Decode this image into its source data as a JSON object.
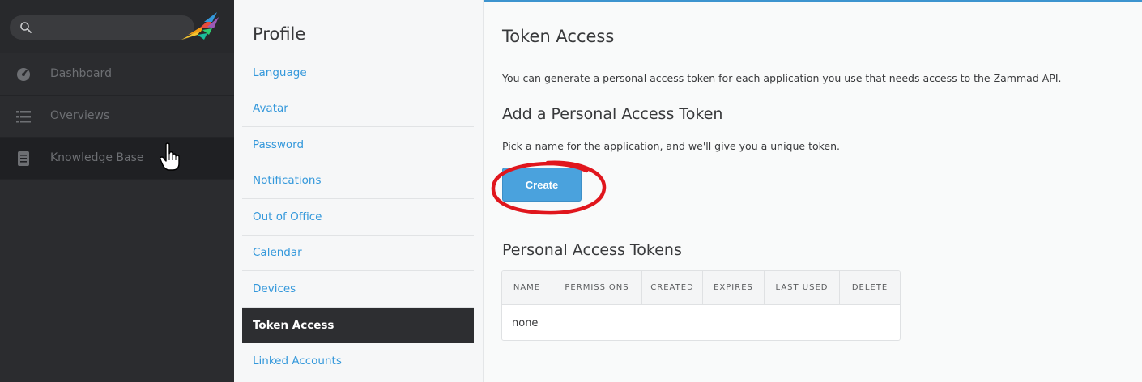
{
  "nav": {
    "search": {
      "placeholder": ""
    },
    "items": [
      {
        "label": "Dashboard",
        "icon": "dashboard-icon"
      },
      {
        "label": "Overviews",
        "icon": "overviews-icon"
      },
      {
        "label": "Knowledge Base",
        "icon": "knowledge-base-icon",
        "active": true
      }
    ]
  },
  "submenu": {
    "title": "Profile",
    "items": [
      {
        "label": "Language"
      },
      {
        "label": "Avatar"
      },
      {
        "label": "Password"
      },
      {
        "label": "Notifications"
      },
      {
        "label": "Out of Office"
      },
      {
        "label": "Calendar"
      },
      {
        "label": "Devices"
      },
      {
        "label": "Token Access",
        "active": true
      },
      {
        "label": "Linked Accounts"
      }
    ]
  },
  "main": {
    "title": "Token Access",
    "intro": "You can generate a personal access token for each application you use that needs access to the Zammad API.",
    "add_section": {
      "title": "Add a Personal Access Token",
      "description": "Pick a name for the application, and we'll give you a unique token.",
      "create_label": "Create"
    },
    "tokens_section": {
      "title": "Personal Access Tokens",
      "columns": [
        "NAME",
        "PERMISSIONS",
        "CREATED",
        "EXPIRES",
        "LAST USED",
        "DELETE"
      ],
      "empty_text": "none"
    }
  },
  "colors": {
    "accent": "#3498db",
    "button": "#4aa2dd",
    "nav_bg": "#2b2c2f",
    "annotation": "#e0161d"
  }
}
